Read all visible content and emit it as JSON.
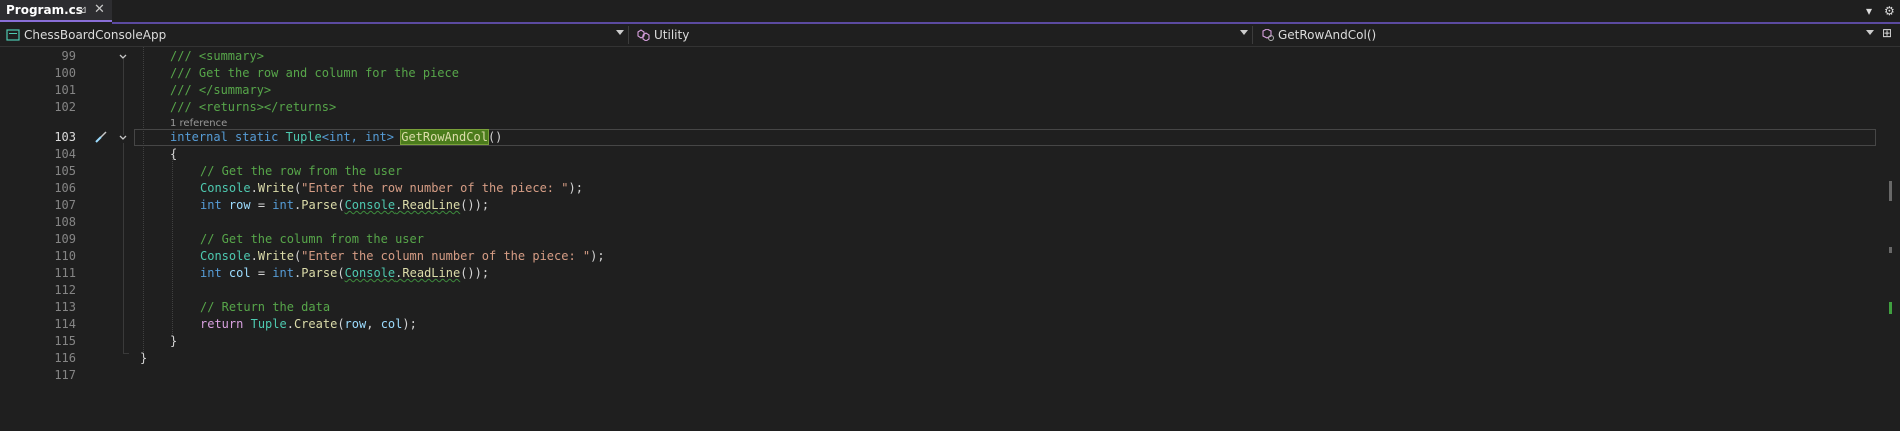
{
  "tab": {
    "title": "Program.cs",
    "pin_icon": "pin-icon",
    "close_icon": "close-icon",
    "pin_glyph": "⊿",
    "close_glyph": "✕"
  },
  "top_right": {
    "dropdown_icon": "chevron-down-icon",
    "dropdown_glyph": "▾",
    "settings_icon": "gear-icon",
    "settings_glyph": "⚙"
  },
  "navbar": {
    "project": "ChessBoardConsoleApp",
    "type": "Utility",
    "member": "GetRowAndCol()",
    "split_icon": "split-editor-icon",
    "split_glyph": "⊞"
  },
  "editor": {
    "codelens_text": "1 reference",
    "lines": [
      {
        "num": "99"
      },
      {
        "num": "100"
      },
      {
        "num": "101"
      },
      {
        "num": "102"
      },
      {
        "num": "103"
      },
      {
        "num": "104"
      },
      {
        "num": "105"
      },
      {
        "num": "106"
      },
      {
        "num": "107"
      },
      {
        "num": "108"
      },
      {
        "num": "109"
      },
      {
        "num": "110"
      },
      {
        "num": "111"
      },
      {
        "num": "112"
      },
      {
        "num": "113"
      },
      {
        "num": "114"
      },
      {
        "num": "115"
      },
      {
        "num": "116"
      },
      {
        "num": "117"
      }
    ],
    "code": {
      "l99": "/// <summary>",
      "l100": "/// Get the row and column for the piece",
      "l101": "/// </summary>",
      "l102": "/// <returns></returns>",
      "l103": {
        "kw1": "internal",
        "kw2": "static",
        "type": "Tuple",
        "generic": "<int, int>",
        "method": "GetRowAndCol",
        "tail": "()"
      },
      "l104": "{",
      "l105": "// Get the row from the user",
      "l106": {
        "cls": "Console",
        "dot": ".",
        "method": "Write",
        "open": "(",
        "str": "\"Enter the row number of the piece: \"",
        "close": ");"
      },
      "l107": {
        "kw": "int",
        "var": "row",
        "eq": " = ",
        "kw2": "int",
        "dot": ".",
        "method": "Parse",
        "open": "(",
        "cls": "Console",
        "dot2": ".",
        "method2": "ReadLine",
        "close": "());"
      },
      "l108": "",
      "l109": "// Get the column from the user",
      "l110": {
        "cls": "Console",
        "dot": ".",
        "method": "Write",
        "open": "(",
        "str": "\"Enter the column number of the piece: \"",
        "close": ");"
      },
      "l111": {
        "kw": "int",
        "var": "col",
        "eq": " = ",
        "kw2": "int",
        "dot": ".",
        "method": "Parse",
        "open": "(",
        "cls": "Console",
        "dot2": ".",
        "method2": "ReadLine",
        "close": "());"
      },
      "l112": "",
      "l113": "// Return the data",
      "l114": {
        "kw": "return",
        "cls": "Tuple",
        "dot": ".",
        "method": "Create",
        "open": "(",
        "a": "row",
        "comma": ", ",
        "b": "col",
        "close": ");"
      },
      "l115": "}",
      "l116": "}"
    },
    "active_line": "103",
    "quick_action_icon": "screwdriver-icon",
    "quick_action_glyph": "🔧",
    "fold_icon": "chevron-down-icon",
    "fold_glyph": "⌄"
  },
  "colors": {
    "accent": "#8a6fd8",
    "comment": "#57a64a",
    "keyword": "#569cd6",
    "type": "#4ec9b0",
    "method": "#dcdcaa",
    "string": "#d69d85"
  }
}
